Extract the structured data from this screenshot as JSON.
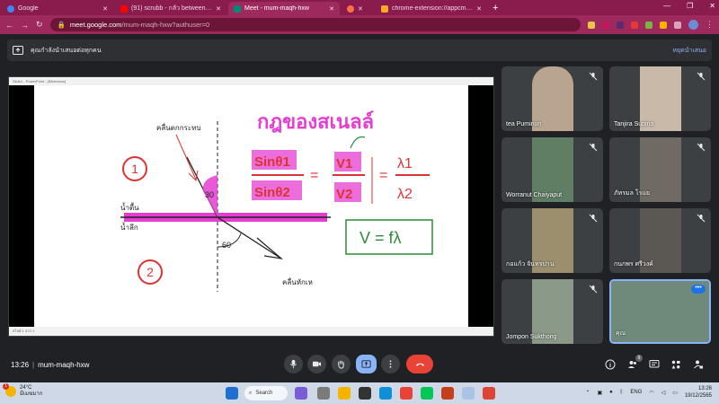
{
  "browser": {
    "tabs": [
      {
        "title": "Google",
        "favicon_color": "#4285f4",
        "active": false
      },
      {
        "title": "(91) scrubb - กลัว between (18th...",
        "favicon_color": "#ff0000",
        "active": false
      },
      {
        "title": "Meet - mum-maqh-hxw",
        "favicon_color": "#00897b",
        "active": true
      },
      {
        "title": "",
        "favicon_color": "#ff7043",
        "active": false
      },
      {
        "title": "chrome-extension://appcmlef...",
        "favicon_color": "#f9a825",
        "active": false
      }
    ],
    "url_host": "meet.google.com",
    "url_path": "/mum-maqh-hxw?authuser=0"
  },
  "presenting_bar": {
    "message": "คุณกำลังนำเสนอต่อทุกคน",
    "stop_label": "หยุดนำเสนอ"
  },
  "shared_screen": {
    "window_title": "Slide1 - PowerPoint - [Slideshow]",
    "status_text": "สไลด์ 1 จาก 1",
    "slide": {
      "title": "กฎของสเนลล์",
      "label_incident": "คลื่นตกกระทบ",
      "label_shallow": "น้ำตื้น",
      "label_deep": "น้ำลึก",
      "label_refracted": "คลื่นหักเห",
      "angle_1": "30",
      "angle_2": "60",
      "region_1": "1",
      "region_2": "2",
      "eq_sin1": "Sinθ1",
      "eq_sin2": "Sinθ2",
      "eq_v1": "V1",
      "eq_v2": "V2",
      "eq_lambda1": "λ1",
      "eq_lambda2": "λ2",
      "eq_box": "V = fλ"
    }
  },
  "participants": [
    {
      "name": "tea Puminun",
      "bg": "#b9a58f"
    },
    {
      "name": "Tanjira Supina",
      "bg": "#c9b9a9"
    },
    {
      "name": "Worranut Chaiyaput",
      "bg": "#5f7e63"
    },
    {
      "name": "ภัทรมล โรแย",
      "bg": "#6f6a63"
    },
    {
      "name": "กอแก้ว จันทรปาน",
      "bg": "#9b8f6d"
    },
    {
      "name": "กนกพร ศรีวงค์",
      "bg": "#5b5752"
    },
    {
      "name": "Jompon Sukthong",
      "bg": "#8b9a88"
    },
    {
      "name": "คุณ",
      "bg": "#6f8a7a"
    }
  ],
  "meeting": {
    "time": "13:26",
    "code": "mum-maqh-hxw",
    "people_count": "9"
  },
  "taskbar": {
    "temperature": "24°C",
    "weather_text": "มีเมฆมาก",
    "weather_badge": "1",
    "search_label": "Search",
    "language": "ENG",
    "clock_time": "13:26",
    "clock_date": "19/12/2565"
  }
}
